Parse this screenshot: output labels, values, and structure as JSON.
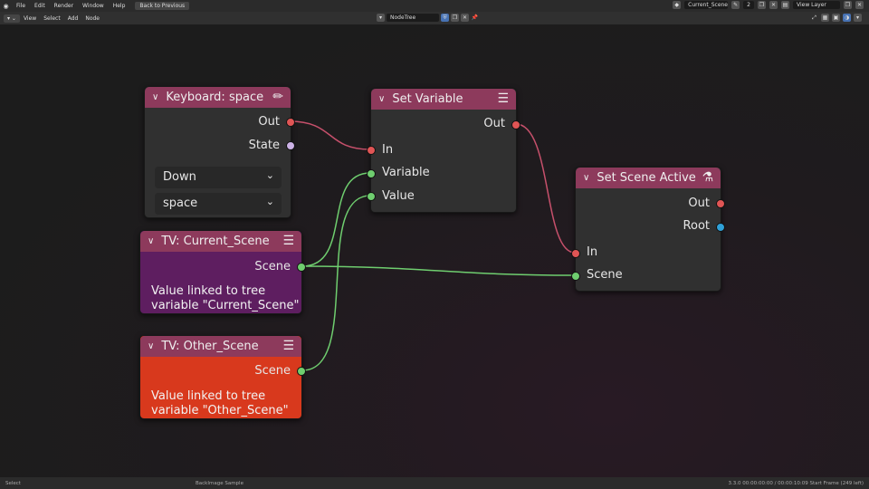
{
  "topbar": {
    "menus": [
      "File",
      "Edit",
      "Render",
      "Window",
      "Help"
    ],
    "back_label": "Back to Previous",
    "scene_name": "Current_Scene",
    "scene_users": "2",
    "view_layer": "View Layer"
  },
  "header": {
    "menus": [
      "View",
      "Select",
      "Add",
      "Node"
    ],
    "tree_name": "NodeTree"
  },
  "nodes": {
    "keyboard": {
      "title": "Keyboard: space",
      "out_label": "Out",
      "state_label": "State",
      "event_value": "Down",
      "key_value": "space"
    },
    "set_variable": {
      "title": "Set Variable",
      "out_label": "Out",
      "in_label": "In",
      "variable_label": "Variable",
      "value_label": "Value"
    },
    "set_scene_active": {
      "title": "Set Scene Active",
      "out_label": "Out",
      "root_label": "Root",
      "in_label": "In",
      "scene_label": "Scene"
    },
    "tv_current": {
      "title": "TV: Current_Scene",
      "scene_label": "Scene",
      "desc_line1": "Value linked to tree",
      "desc_line2": "variable \"Current_Scene\""
    },
    "tv_other": {
      "title": "TV: Other_Scene",
      "scene_label": "Scene",
      "desc_line1": "Value linked to tree",
      "desc_line2": "variable \"Other_Scene\""
    }
  },
  "status": {
    "left": "Select",
    "middle": "BackImage Sample",
    "right": "3.3.0   00:00:00:00 / 00:00:10:09   Start Frame (249 left)"
  },
  "colors": {
    "node_header": "#8d3a5c",
    "tv_current_body": "#5e1e60",
    "tv_other_body": "#d8391d",
    "link_red": "#c6506b",
    "link_green": "#6fce6f"
  }
}
